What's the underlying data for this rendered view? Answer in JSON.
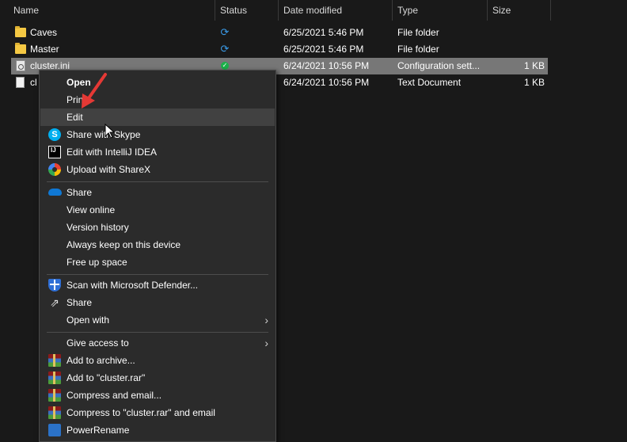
{
  "columns": {
    "name": "Name",
    "status": "Status",
    "date_modified": "Date modified",
    "type": "Type",
    "size": "Size"
  },
  "files": [
    {
      "name": "Caves",
      "icon": "folder-icon",
      "status": "sync",
      "date": "6/25/2021 5:46 PM",
      "type": "File folder",
      "size": ""
    },
    {
      "name": "Master",
      "icon": "folder-icon",
      "status": "sync",
      "date": "6/25/2021 5:46 PM",
      "type": "File folder",
      "size": ""
    },
    {
      "name": "cluster.ini",
      "icon": "config-file-icon",
      "status": "available",
      "date": "6/24/2021 10:56 PM",
      "type": "Configuration sett...",
      "size": "1 KB",
      "selected": true
    },
    {
      "name": "cl",
      "icon": "text-file-icon",
      "status": "",
      "date": "6/24/2021 10:56 PM",
      "type": "Text Document",
      "size": "1 KB"
    }
  ],
  "context_menu": {
    "open": "Open",
    "print": "Print",
    "edit": "Edit",
    "share_skype": "Share with Skype",
    "edit_intellij": "Edit with IntelliJ IDEA",
    "upload_sharex": "Upload with ShareX",
    "share_onedrive": "Share",
    "view_online": "View online",
    "version_history": "Version history",
    "always_keep": "Always keep on this device",
    "free_up_space": "Free up space",
    "scan_defender": "Scan with Microsoft Defender...",
    "share": "Share",
    "open_with": "Open with",
    "give_access": "Give access to",
    "add_archive": "Add to archive...",
    "add_cluster_rar": "Add to \"cluster.rar\"",
    "compress_email": "Compress and email...",
    "compress_cluster_email": "Compress to \"cluster.rar\" and email",
    "power_rename": "PowerRename"
  },
  "icons": {
    "intellij_text": "IJ"
  },
  "colors": {
    "background": "#191919",
    "menu_background": "#2b2b2b",
    "selected_row": "#777777",
    "annotation_arrow": "#e53935"
  }
}
